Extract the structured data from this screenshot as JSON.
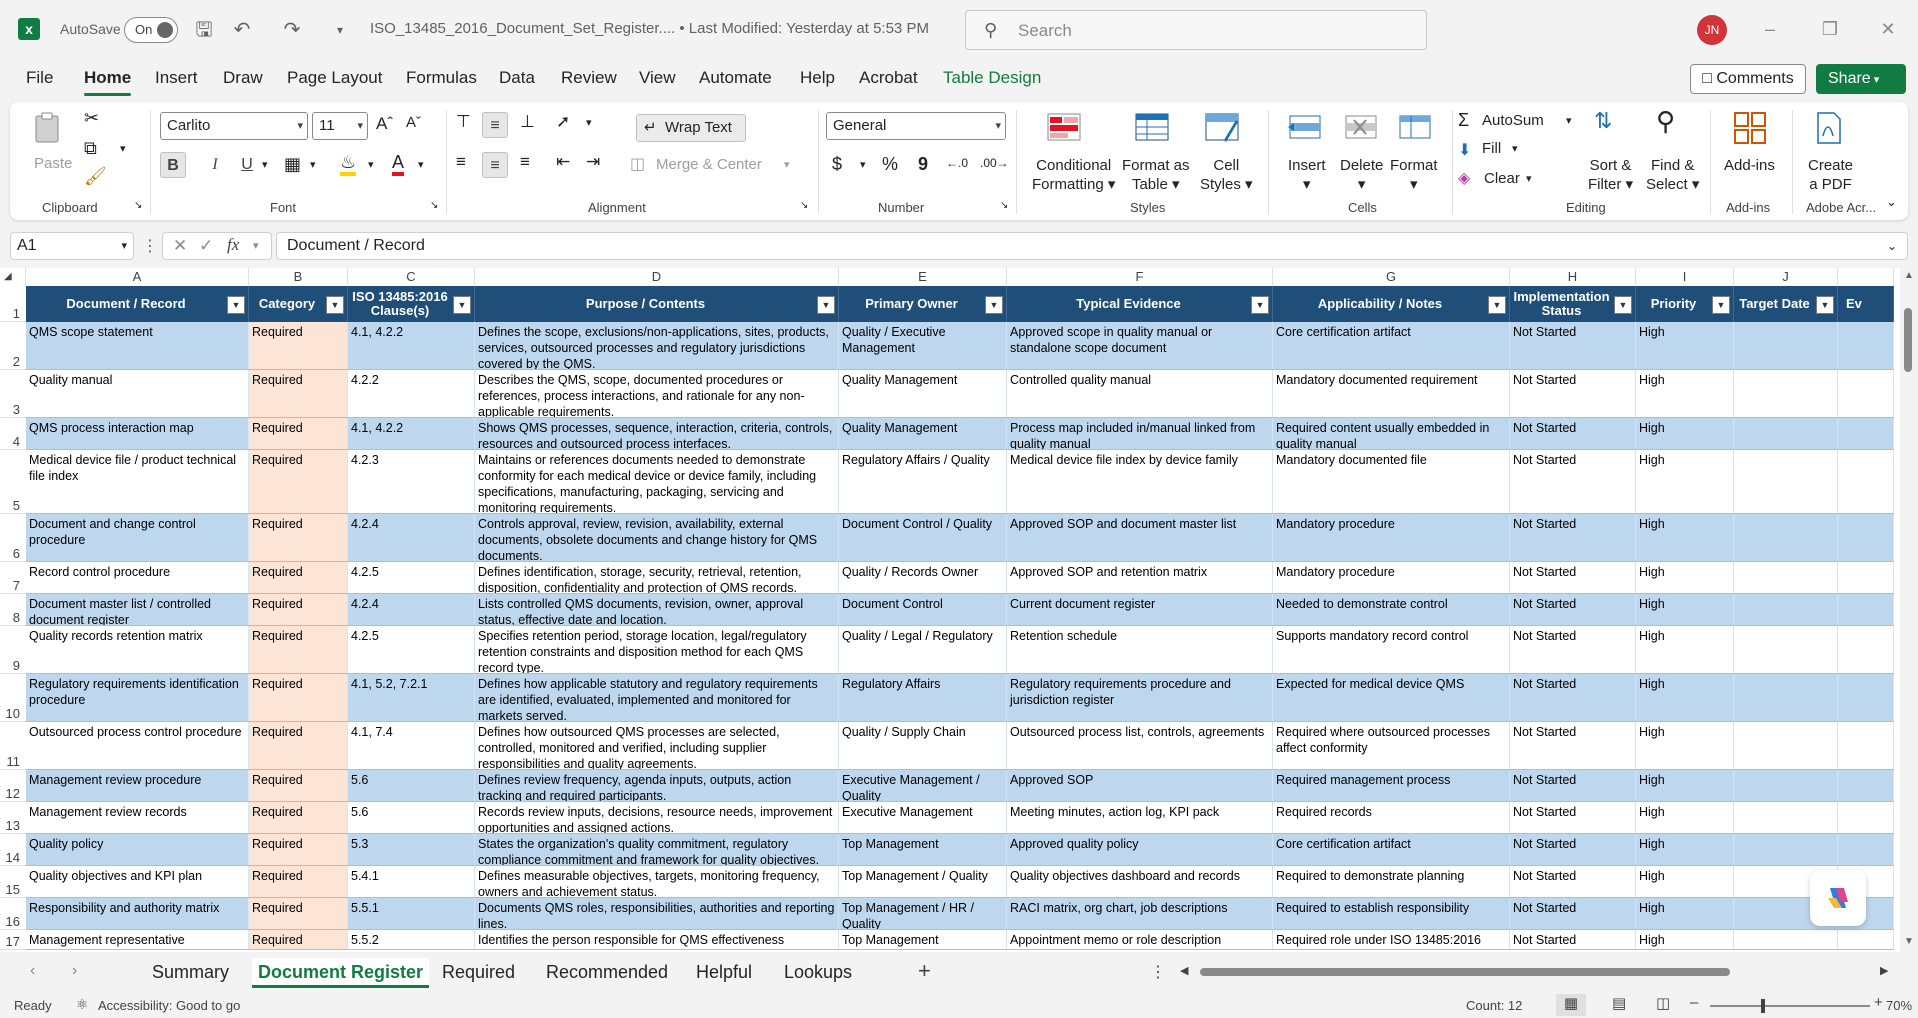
{
  "app": {
    "autosave_label": "AutoSave",
    "autosave_state": "On",
    "doc_title": "ISO_13485_2016_Document_Set_Register....  •  Last Modified: Yesterday at 5:53 PM",
    "search_placeholder": "Search",
    "user_initials": "JN",
    "accent": "#107c41"
  },
  "menu": {
    "tabs": [
      "File",
      "Home",
      "Insert",
      "Draw",
      "Page Layout",
      "Formulas",
      "Data",
      "Review",
      "View",
      "Automate",
      "Help",
      "Acrobat",
      "Table Design"
    ],
    "comments": "Comments",
    "share": "Share"
  },
  "ribbon": {
    "clipboard": {
      "paste": "Paste",
      "label": "Clipboard"
    },
    "font": {
      "name": "Carlito",
      "size": "11",
      "label": "Font",
      "bold": "B",
      "italic": "I",
      "underline": "U"
    },
    "alignment": {
      "wrap": "Wrap Text",
      "merge": "Merge & Center",
      "label": "Alignment"
    },
    "number": {
      "format": "General",
      "label": "Number",
      "currency": "$",
      "percent": "%",
      "comma": "9"
    },
    "styles": {
      "cond": "Conditional Formatting",
      "cond1": "Conditional",
      "cond2": "Formatting",
      "fmt1": "Format as",
      "fmt2": "Table",
      "cell1": "Cell",
      "cell2": "Styles",
      "label": "Styles"
    },
    "cells": {
      "insert": "Insert",
      "delete": "Delete",
      "format": "Format",
      "label": "Cells"
    },
    "editing": {
      "autosum": "AutoSum",
      "fill": "Fill",
      "clear": "Clear",
      "sort1": "Sort &",
      "sort2": "Filter",
      "find1": "Find &",
      "find2": "Select",
      "label": "Editing"
    },
    "addins": {
      "btn": "Add-ins",
      "label": "Add-ins"
    },
    "acrobat": {
      "btn1": "Create",
      "btn2": "a PDF",
      "label": "Adobe Acr..."
    }
  },
  "formula_bar": {
    "cell_ref": "A1",
    "fx": "fx",
    "content": "Document / Record"
  },
  "columns": [
    "A",
    "B",
    "C",
    "D",
    "E",
    "F",
    "G",
    "H",
    "I",
    "J"
  ],
  "table_headers": [
    "Document / Record",
    "Category",
    "ISO 13485:2016 Clause(s)",
    "Purpose / Contents",
    "Primary Owner",
    "Typical Evidence",
    "Applicability / Notes",
    "Implementation Status",
    "Priority",
    "Target Date",
    "Ev"
  ],
  "rows": [
    {
      "n": "2",
      "a": "QMS scope statement",
      "b": "Required",
      "c": "4.1, 4.2.2",
      "d": "Defines the scope, exclusions/non-applications, sites, products, services, outsourced processes and regulatory jurisdictions covered by the QMS.",
      "e": "Quality / Executive Management",
      "f": "Approved scope in quality manual or standalone scope document",
      "g": "Core certification artifact",
      "h": "Not Started",
      "i": "High"
    },
    {
      "n": "3",
      "a": "Quality manual",
      "b": "Required",
      "c": "4.2.2",
      "d": "Describes the QMS, scope, documented procedures or references, process interactions, and rationale for any non-applicable requirements.",
      "e": "Quality Management",
      "f": "Controlled quality manual",
      "g": "Mandatory documented requirement",
      "h": "Not Started",
      "i": "High"
    },
    {
      "n": "4",
      "a": "QMS process interaction map",
      "b": "Required",
      "c": "4.1, 4.2.2",
      "d": "Shows QMS processes, sequence, interaction, criteria, controls, resources and outsourced process interfaces.",
      "e": "Quality Management",
      "f": "Process map included in/manual linked from quality manual",
      "g": "Required content usually embedded in quality manual",
      "h": "Not Started",
      "i": "High"
    },
    {
      "n": "5",
      "a": "Medical device file / product technical file index",
      "b": "Required",
      "c": "4.2.3",
      "d": "Maintains or references documents needed to demonstrate conformity for each medical device or device family, including specifications, manufacturing, packaging, servicing and monitoring requirements.",
      "e": "Regulatory Affairs / Quality",
      "f": "Medical device file index by device family",
      "g": "Mandatory documented file",
      "h": "Not Started",
      "i": "High"
    },
    {
      "n": "6",
      "a": "Document and change control procedure",
      "b": "Required",
      "c": "4.2.4",
      "d": "Controls approval, review, revision, availability, external documents, obsolete documents and change history for QMS documents.",
      "e": "Document Control / Quality",
      "f": "Approved SOP and document master list",
      "g": "Mandatory procedure",
      "h": "Not Started",
      "i": "High"
    },
    {
      "n": "7",
      "a": "Record control procedure",
      "b": "Required",
      "c": "4.2.5",
      "d": "Defines identification, storage, security, retrieval, retention, disposition, confidentiality and protection of QMS records.",
      "e": "Quality / Records Owner",
      "f": "Approved SOP and retention matrix",
      "g": "Mandatory procedure",
      "h": "Not Started",
      "i": "High"
    },
    {
      "n": "8",
      "a": "Document master list / controlled document register",
      "b": "Required",
      "c": "4.2.4",
      "d": "Lists controlled QMS documents, revision, owner, approval status, effective date and location.",
      "e": "Document Control",
      "f": "Current document register",
      "g": "Needed to demonstrate control",
      "h": "Not Started",
      "i": "High"
    },
    {
      "n": "9",
      "a": "Quality records retention matrix",
      "b": "Required",
      "c": "4.2.5",
      "d": "Specifies retention period, storage location, legal/regulatory retention constraints and disposition method for each QMS record type.",
      "e": "Quality / Legal / Regulatory",
      "f": "Retention schedule",
      "g": "Supports mandatory record control",
      "h": "Not Started",
      "i": "High"
    },
    {
      "n": "10",
      "a": "Regulatory requirements identification procedure",
      "b": "Required",
      "c": "4.1, 5.2, 7.2.1",
      "d": "Defines how applicable statutory and regulatory requirements are identified, evaluated, implemented and monitored for markets served.",
      "e": "Regulatory Affairs",
      "f": "Regulatory requirements procedure and jurisdiction register",
      "g": "Expected for medical device QMS",
      "h": "Not Started",
      "i": "High"
    },
    {
      "n": "11",
      "a": "Outsourced process control procedure",
      "b": "Required",
      "c": "4.1, 7.4",
      "d": "Defines how outsourced QMS processes are selected, controlled, monitored and verified, including supplier responsibilities and quality agreements.",
      "e": "Quality / Supply Chain",
      "f": "Outsourced process list, controls, agreements",
      "g": "Required where outsourced processes affect conformity",
      "h": "Not Started",
      "i": "High"
    },
    {
      "n": "12",
      "a": "Management review procedure",
      "b": "Required",
      "c": "5.6",
      "d": "Defines review frequency, agenda inputs, outputs, action tracking and required participants.",
      "e": "Executive Management / Quality",
      "f": "Approved SOP",
      "g": "Required management process",
      "h": "Not Started",
      "i": "High"
    },
    {
      "n": "13",
      "a": "Management review records",
      "b": "Required",
      "c": "5.6",
      "d": "Records review inputs, decisions, resource needs, improvement opportunities and assigned actions.",
      "e": "Executive Management",
      "f": "Meeting minutes, action log, KPI pack",
      "g": "Required records",
      "h": "Not Started",
      "i": "High"
    },
    {
      "n": "14",
      "a": "Quality policy",
      "b": "Required",
      "c": "5.3",
      "d": "States the organization's quality commitment, regulatory compliance commitment and framework for quality objectives.",
      "e": "Top Management",
      "f": "Approved quality policy",
      "g": "Core certification artifact",
      "h": "Not Started",
      "i": "High"
    },
    {
      "n": "15",
      "a": "Quality objectives and KPI plan",
      "b": "Required",
      "c": "5.4.1",
      "d": "Defines measurable objectives, targets, monitoring frequency, owners and achievement status.",
      "e": "Top Management / Quality",
      "f": "Quality objectives dashboard and records",
      "g": "Required to demonstrate planning",
      "h": "Not Started",
      "i": "High"
    },
    {
      "n": "16",
      "a": "Responsibility and authority matrix",
      "b": "Required",
      "c": "5.5.1",
      "d": "Documents QMS roles, responsibilities, authorities and reporting lines.",
      "e": "Top Management / HR / Quality",
      "f": "RACI matrix, org chart, job descriptions",
      "g": "Required to establish responsibility",
      "h": "Not Started",
      "i": "High"
    },
    {
      "n": "17",
      "a": "Management representative",
      "b": "Required",
      "c": "5.5.2",
      "d": "Identifies the person responsible for QMS effectiveness",
      "e": "Top Management",
      "f": "Appointment memo or role description",
      "g": "Required role under ISO 13485:2016",
      "h": "Not Started",
      "i": "High"
    }
  ],
  "sheets": [
    "Summary",
    "Document Register",
    "Required",
    "Recommended",
    "Helpful",
    "Lookups"
  ],
  "status": {
    "ready": "Ready",
    "accessibility": "Accessibility: Good to go",
    "count": "Count: 12",
    "zoom": "70%"
  }
}
